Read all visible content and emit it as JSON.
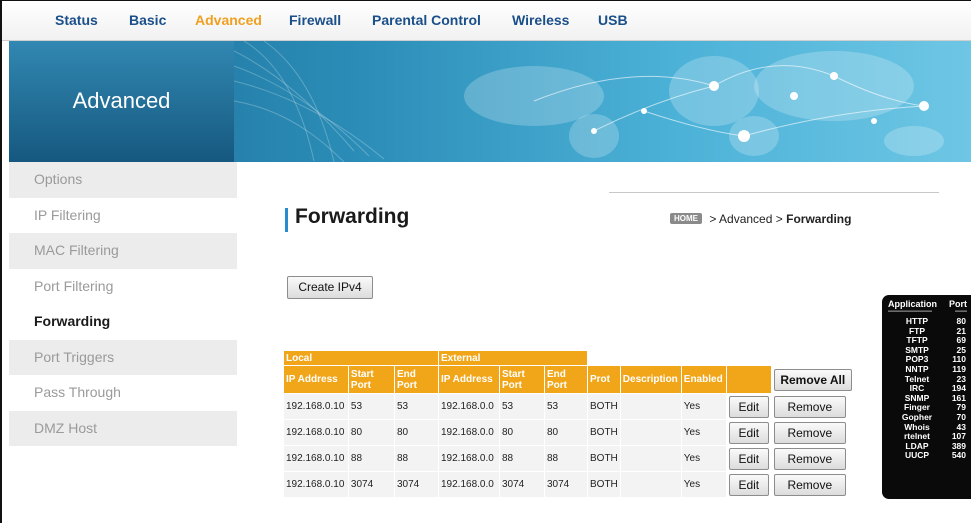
{
  "nav": {
    "items": [
      {
        "label": "Status",
        "active": false
      },
      {
        "label": "Basic",
        "active": false
      },
      {
        "label": "Advanced",
        "active": true
      },
      {
        "label": "Firewall",
        "active": false
      },
      {
        "label": "Parental Control",
        "active": false
      },
      {
        "label": "Wireless",
        "active": false
      },
      {
        "label": "USB",
        "active": false
      }
    ]
  },
  "banner": {
    "title": "Advanced"
  },
  "sidebar": {
    "items": [
      {
        "label": "Options"
      },
      {
        "label": "IP Filtering"
      },
      {
        "label": "MAC Filtering"
      },
      {
        "label": "Port Filtering"
      },
      {
        "label": "Forwarding",
        "active": true
      },
      {
        "label": "Port Triggers"
      },
      {
        "label": "Pass Through"
      },
      {
        "label": "DMZ Host"
      }
    ]
  },
  "page": {
    "title": "Forwarding",
    "breadcrumb": {
      "home": "HOME",
      "sep": ">",
      "section": "Advanced",
      "current": "Forwarding"
    },
    "create_button": "Create IPv4"
  },
  "table": {
    "group_local": "Local",
    "group_external": "External",
    "headers": {
      "local_ip": "IP Address",
      "local_start": "Start Port",
      "local_end": "End Port",
      "ext_ip": "IP Address",
      "ext_start": "Start Port",
      "ext_end": "End Port",
      "prot": "Prot",
      "description": "Description",
      "enabled": "Enabled"
    },
    "remove_all": "Remove All",
    "edit_label": "Edit",
    "remove_label": "Remove",
    "rows": [
      {
        "local_ip": "192.168.0.10",
        "local_start": "53",
        "local_end": "53",
        "ext_ip": "192.168.0.0",
        "ext_start": "53",
        "ext_end": "53",
        "prot": "BOTH",
        "description": "",
        "enabled": "Yes"
      },
      {
        "local_ip": "192.168.0.10",
        "local_start": "80",
        "local_end": "80",
        "ext_ip": "192.168.0.0",
        "ext_start": "80",
        "ext_end": "80",
        "prot": "BOTH",
        "description": "",
        "enabled": "Yes"
      },
      {
        "local_ip": "192.168.0.10",
        "local_start": "88",
        "local_end": "88",
        "ext_ip": "192.168.0.0",
        "ext_start": "88",
        "ext_end": "88",
        "prot": "BOTH",
        "description": "",
        "enabled": "Yes"
      },
      {
        "local_ip": "192.168.0.10",
        "local_start": "3074",
        "local_end": "3074",
        "ext_ip": "192.168.0.0",
        "ext_start": "3074",
        "ext_end": "3074",
        "prot": "BOTH",
        "description": "",
        "enabled": "Yes"
      }
    ]
  },
  "port_legend": {
    "header_app": "Application",
    "header_port": "Port",
    "divider_app": "----------------------",
    "divider_port": "------",
    "entries": [
      {
        "app": "HTTP",
        "port": "80"
      },
      {
        "app": "FTP",
        "port": "21"
      },
      {
        "app": "TFTP",
        "port": "69"
      },
      {
        "app": "SMTP",
        "port": "25"
      },
      {
        "app": "POP3",
        "port": "110"
      },
      {
        "app": "NNTP",
        "port": "119"
      },
      {
        "app": "Telnet",
        "port": "23"
      },
      {
        "app": "IRC",
        "port": "194"
      },
      {
        "app": "SNMP",
        "port": "161"
      },
      {
        "app": "Finger",
        "port": "79"
      },
      {
        "app": "Gopher",
        "port": "70"
      },
      {
        "app": "Whois",
        "port": "43"
      },
      {
        "app": "rtelnet",
        "port": "107"
      },
      {
        "app": "LDAP",
        "port": "389"
      },
      {
        "app": "UUCP",
        "port": "540"
      }
    ]
  },
  "colors": {
    "nav_text": "#1a4f8a",
    "nav_active": "#f0a020",
    "table_header": "#f1a61a",
    "banner": "#2a8cb6"
  }
}
